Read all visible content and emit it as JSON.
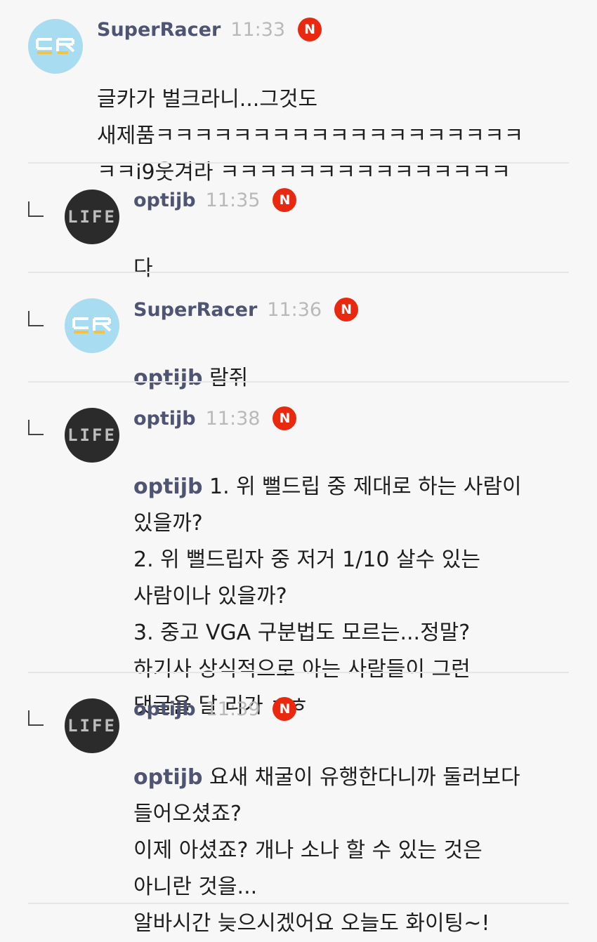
{
  "comments": [
    {
      "nick": "SuperRacer",
      "time": "11:33",
      "badge": "N",
      "text": "글카가 벌크라니...그것도\n새제품ㅋㅋㅋㅋㅋㅋㅋㅋㅋㅋㅋㅋㅋㅋㅋㅋㅋㅋㅋ\nㅋㅋi9웃겨라 ㅋㅋㅋㅋㅋㅋㅋㅋㅋㅋㅋㅋㅋㅋㅋ"
    },
    {
      "nick": "optijb",
      "time": "11:35",
      "badge": "N",
      "text": "다"
    },
    {
      "nick": "SuperRacer",
      "time": "11:36",
      "badge": "N",
      "mention": "optijb",
      "text": " 람쥐"
    },
    {
      "nick": "optijb",
      "time": "11:38",
      "badge": "N",
      "mention": "optijb",
      "text": " 1. 위 뻘드립 중 제대로 하는 사람이\n있을까?\n2. 위 뻘드립자 중 저거 1/10 살수 있는\n사람이나 있을까?\n3. 중고 VGA 구분법도 모르는...정말?\n하기사 상식적으로 아는 사람들이 그런\n댓글을 달 리가 ㅎㅎ"
    },
    {
      "nick": "optijb",
      "time": "11:39",
      "badge": "N",
      "mention": "optijb",
      "text": " 요새 채굴이 유행한다니까 둘러보다\n들어오셨죠?\n이제 아셨죠? 개나 소나 할 수 있는 것은\n아니란 것을...\n알바시간 늦으시겠어요 오늘도 화이팅~!"
    }
  ],
  "avatars": {
    "superracer": "SR",
    "life": "LIFE"
  },
  "colors": {
    "nick": "#4e5472",
    "badge": "#e8280f",
    "time": "#b9b9b9",
    "background": "#f7f7f7"
  }
}
